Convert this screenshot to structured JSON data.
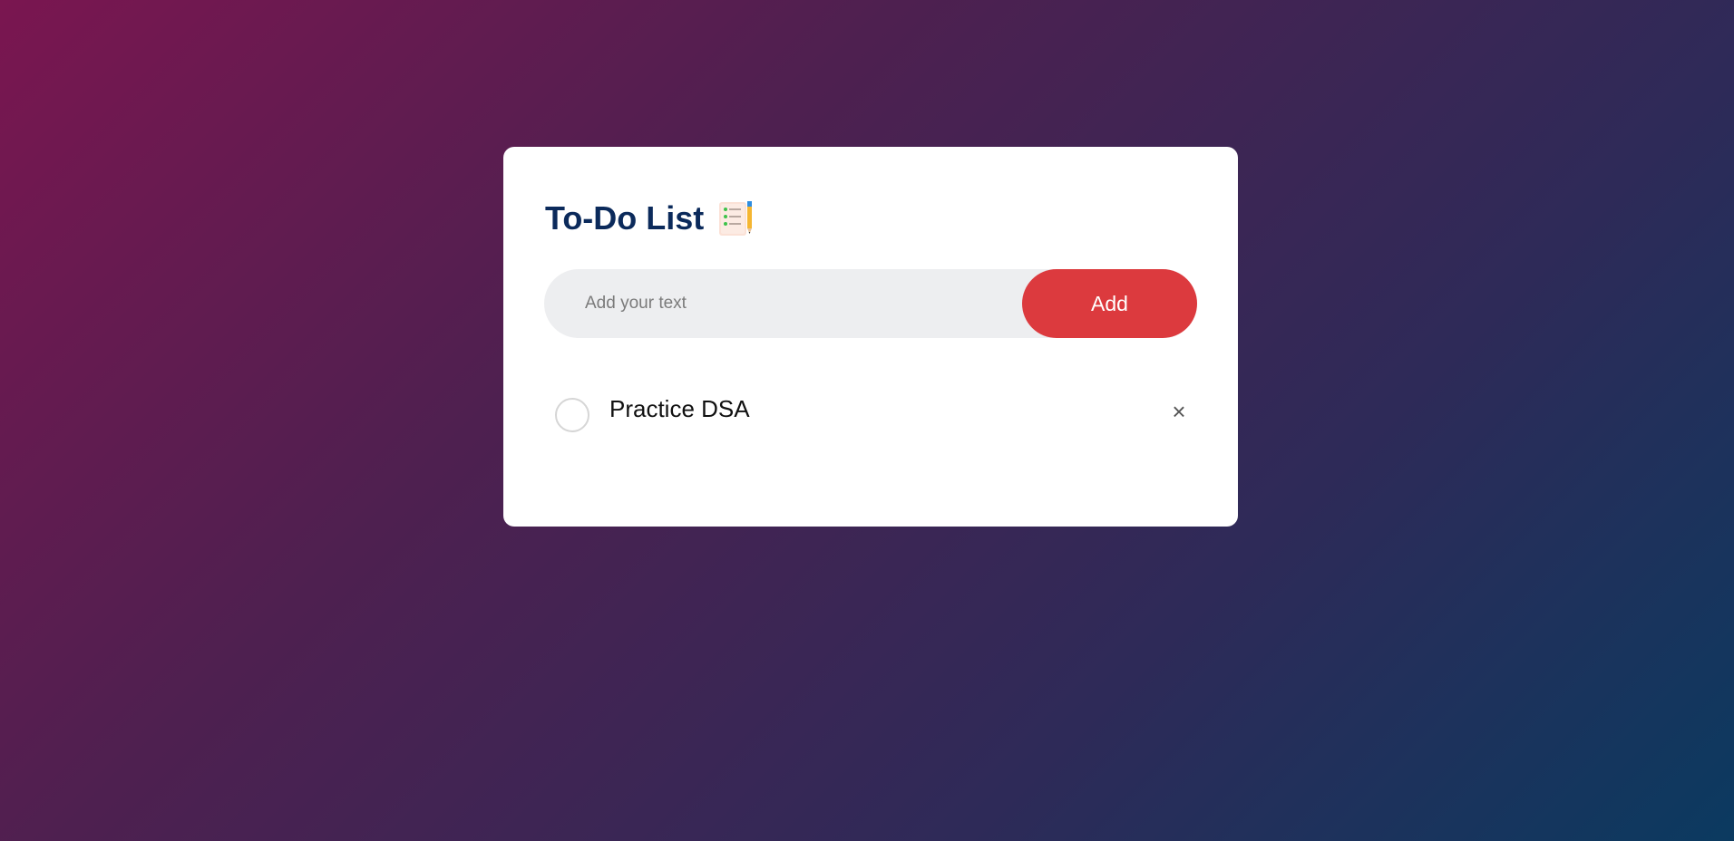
{
  "app": {
    "title": "To-Do List"
  },
  "header": {
    "title_icon": "notepad-checklist-icon"
  },
  "input": {
    "placeholder": "Add your text",
    "value": ""
  },
  "add_button": {
    "label": "Add"
  },
  "tasks": [
    {
      "text": "Practice DSA",
      "checked": false,
      "delete_glyph": "×"
    }
  ],
  "colors": {
    "accent": "#dc3a3e",
    "title": "#0b2a5b",
    "input_bg": "#edeef0"
  }
}
